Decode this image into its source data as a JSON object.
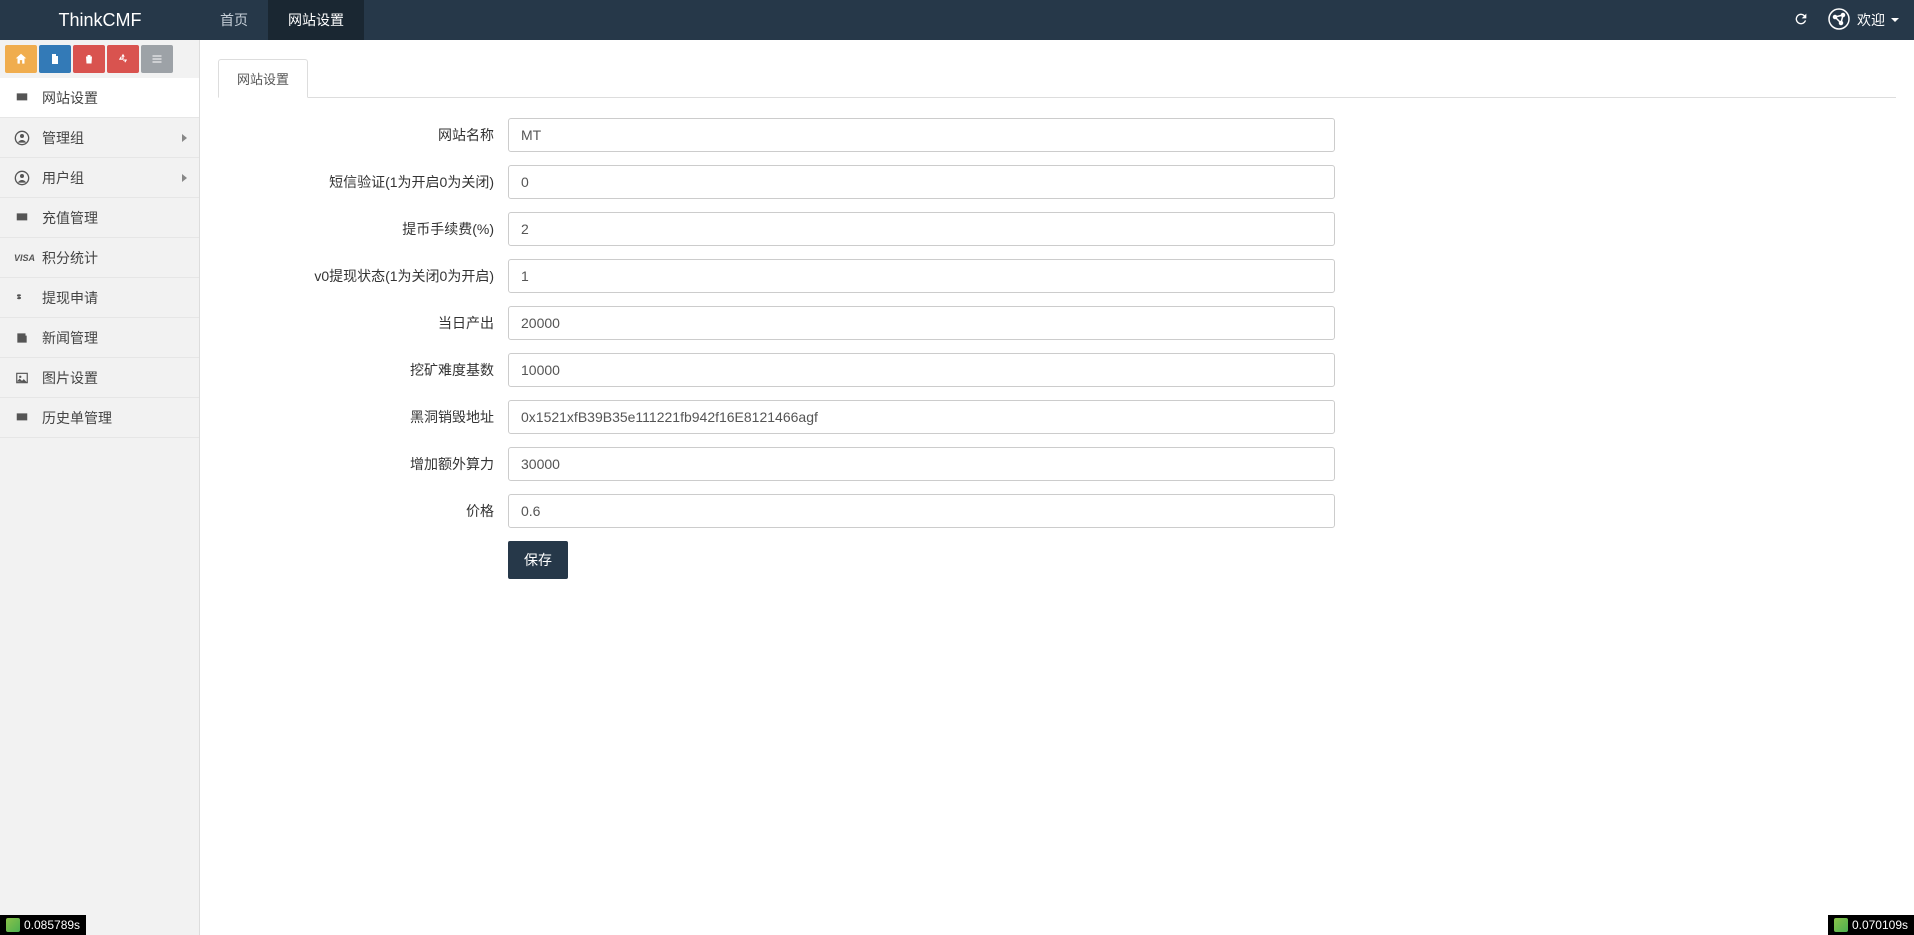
{
  "header": {
    "brand": "ThinkCMF",
    "tabs": [
      {
        "label": "首页",
        "active": false
      },
      {
        "label": "网站设置",
        "active": true
      }
    ],
    "user_label": "欢迎"
  },
  "sidebar": {
    "toolbar_icons": [
      "home",
      "file",
      "trash",
      "recycle",
      "list"
    ],
    "items": [
      {
        "label": "网站设置",
        "icon": "monitor",
        "active": true,
        "expandable": false
      },
      {
        "label": "管理组",
        "icon": "user-circle",
        "active": false,
        "expandable": true
      },
      {
        "label": "用户组",
        "icon": "user-circle",
        "active": false,
        "expandable": true
      },
      {
        "label": "充值管理",
        "icon": "monitor",
        "active": false,
        "expandable": false
      },
      {
        "label": "积分统计",
        "icon": "visa",
        "active": false,
        "expandable": false
      },
      {
        "label": "提现申请",
        "icon": "dollar",
        "active": false,
        "expandable": false
      },
      {
        "label": "新闻管理",
        "icon": "news",
        "active": false,
        "expandable": false
      },
      {
        "label": "图片设置",
        "icon": "image",
        "active": false,
        "expandable": false
      },
      {
        "label": "历史单管理",
        "icon": "monitor",
        "active": false,
        "expandable": false
      }
    ]
  },
  "content": {
    "tab_label": "网站设置",
    "fields": [
      {
        "label": "网站名称",
        "value": "MT"
      },
      {
        "label": "短信验证(1为开启0为关闭)",
        "value": "0"
      },
      {
        "label": "提币手续费(%)",
        "value": "2"
      },
      {
        "label": "v0提现状态(1为关闭0为开启)",
        "value": "1"
      },
      {
        "label": "当日产出",
        "value": "20000"
      },
      {
        "label": "挖矿难度基数",
        "value": "10000"
      },
      {
        "label": "黑洞销毁地址",
        "value": "0x1521xfB39B35e111221fb942f16E8121466agf"
      },
      {
        "label": "增加额外算力",
        "value": "30000"
      },
      {
        "label": "价格",
        "value": "0.6"
      }
    ],
    "save_label": "保存"
  },
  "debug": {
    "left": "0.085789s",
    "right": "0.070109s"
  }
}
